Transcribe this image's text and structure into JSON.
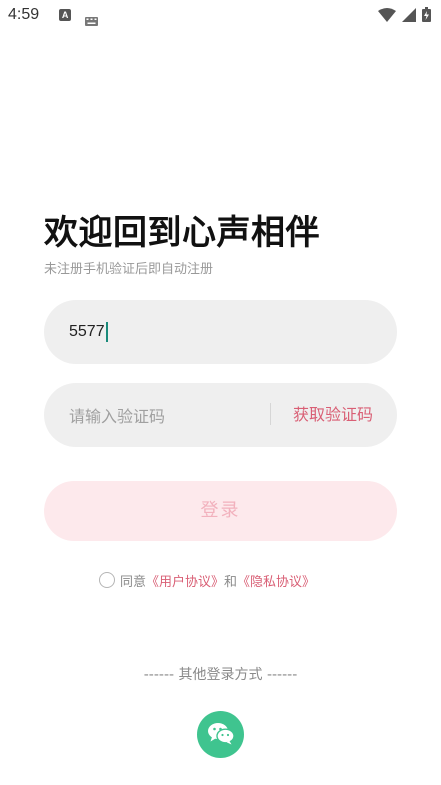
{
  "status_bar": {
    "time": "4:59",
    "notification_badge": "A",
    "icons": [
      "notification-a-icon",
      "keyboard-icon",
      "wifi-icon",
      "signal-icon",
      "battery-icon"
    ]
  },
  "header": {
    "title": "欢迎回到心声相伴",
    "subtitle": "未注册手机验证后即自动注册"
  },
  "form": {
    "phone_value": "5577",
    "code_placeholder": "请输入验证码",
    "get_code_label": "获取验证码",
    "login_label": "登录"
  },
  "agreement": {
    "prefix": "同意",
    "user_agreement": "《用户协议》",
    "conjunction": "和",
    "privacy_policy": "《隐私协议》"
  },
  "other_login": {
    "label": "------ 其他登录方式 ------",
    "methods": [
      "wechat-icon"
    ]
  },
  "colors": {
    "accent": "#d95f75",
    "login_bg": "#fde9ec",
    "login_text": "#f2b1bd",
    "field_bg": "#efefef",
    "wechat": "#3fc48f"
  }
}
